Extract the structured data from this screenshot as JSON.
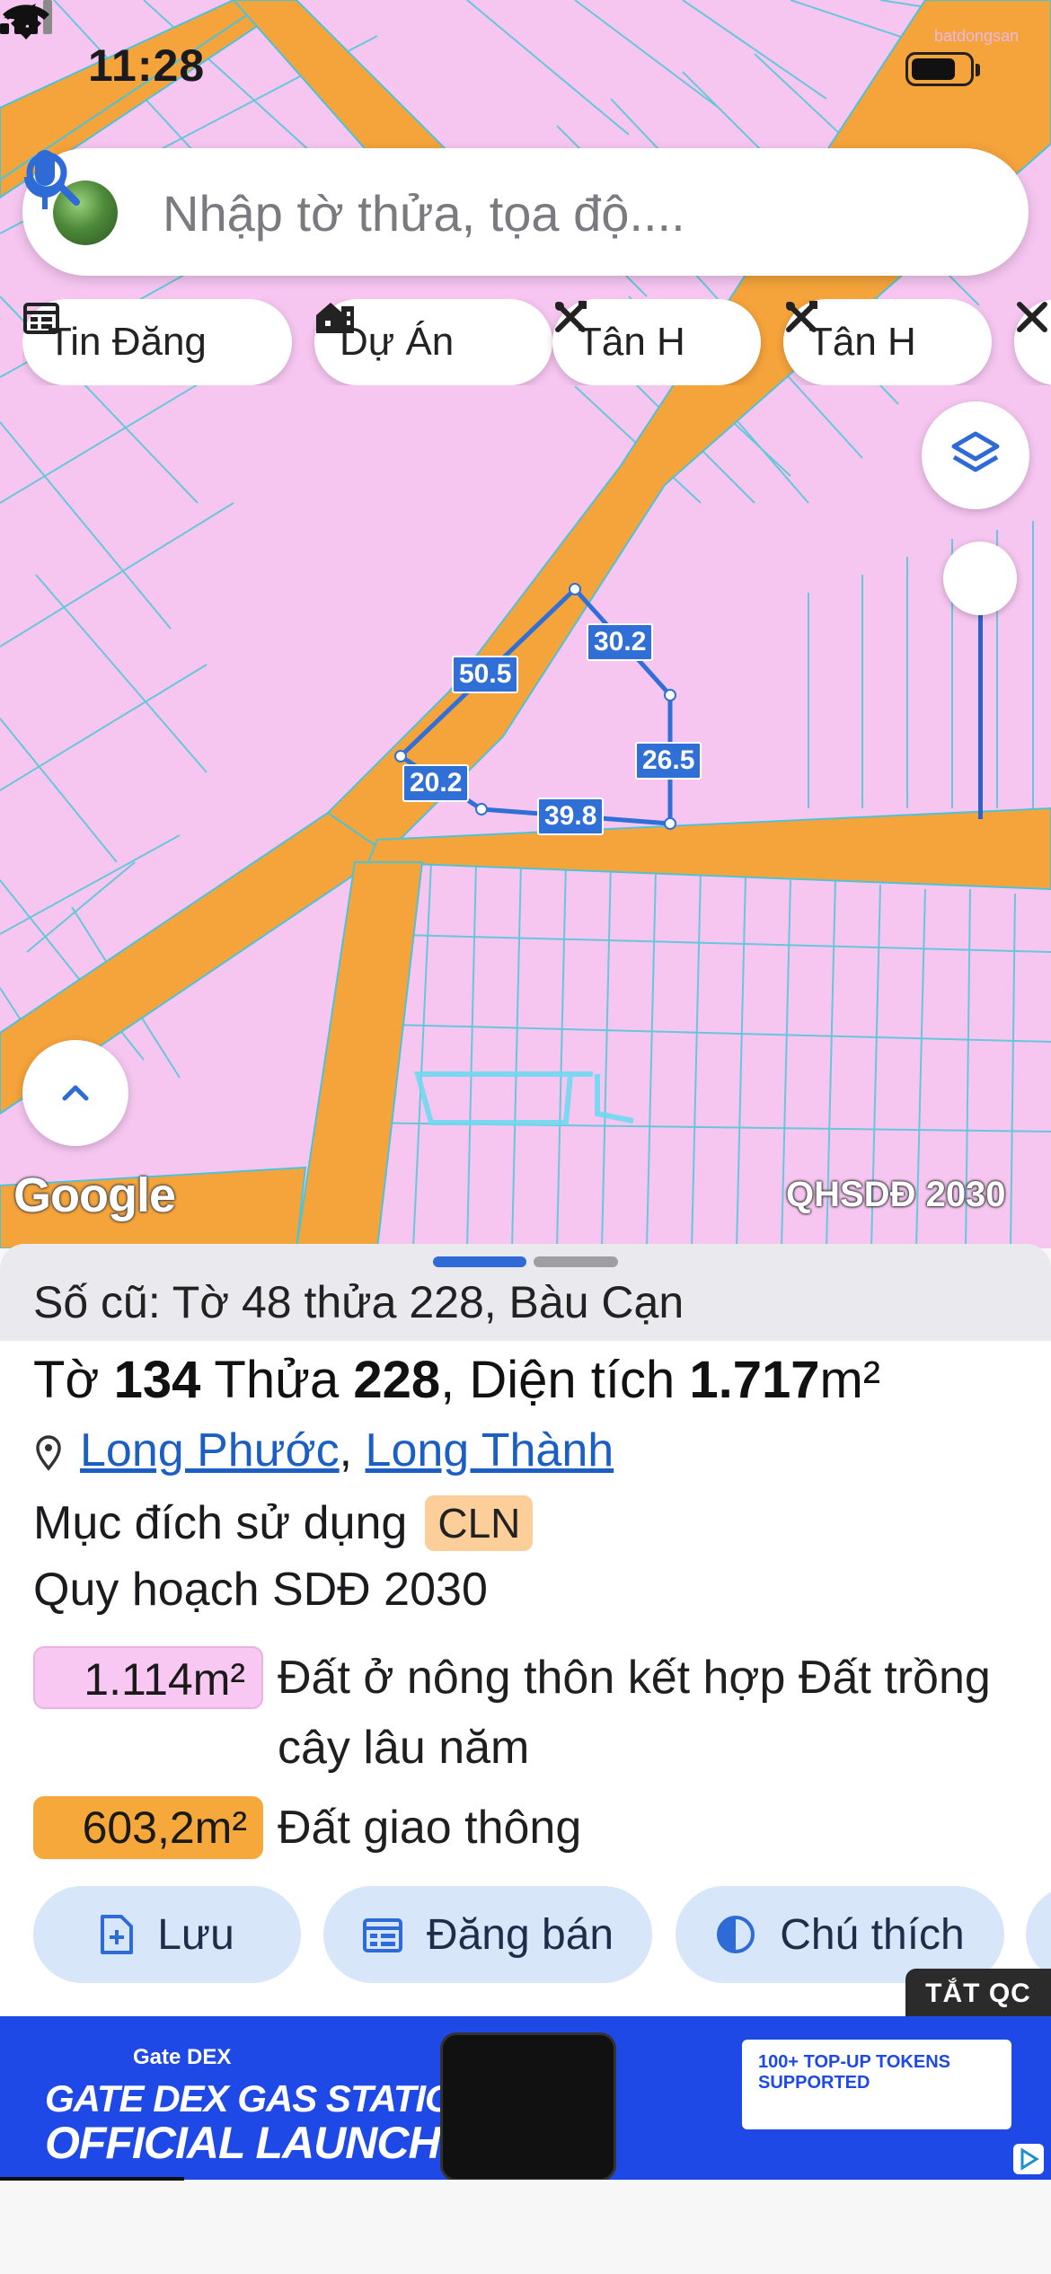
{
  "status_bar": {
    "time": "11:28",
    "watermark": "batdongsan"
  },
  "search": {
    "placeholder": "Nhập tờ thửa, tọa độ...."
  },
  "chips": [
    {
      "label": "Tin Đăng",
      "icon": "calendar-icon"
    },
    {
      "label": "Dự Án",
      "icon": "building-icon"
    },
    {
      "label": "Tân H",
      "icon": "crossed-tools-icon"
    },
    {
      "label": "Tân H",
      "icon": "crossed-tools-icon"
    }
  ],
  "map": {
    "dimensions": [
      "50.5",
      "30.2",
      "26.5",
      "39.8",
      "20.2"
    ],
    "attribution": "Google",
    "plan_label": "QHSDĐ 2030"
  },
  "sheet": {
    "old_info": "Số cũ: Tờ 48 thửa 228, Bàu Cạn",
    "title_prefix": "Tờ ",
    "sheet_no": "134",
    "parcel_word": " Thửa ",
    "parcel_no": "228",
    "area_word": ", Diện tích ",
    "area_value": "1.717",
    "area_unit": "m²",
    "ward": "Long Phước",
    "separator": ", ",
    "district": "Long Thành",
    "purpose_label": "Mục đích sử dụng",
    "purpose_code": "CLN",
    "plan_title": "Quy hoạch SDĐ 2030",
    "plan_items": [
      {
        "area": "1.114m²",
        "desc": "Đất ở nông thôn kết hợp Đất trồng cây lâu năm",
        "color": "#f8c8f3"
      },
      {
        "area": "603,2m²",
        "desc": "Đất giao thông",
        "color": "#f7a83a"
      }
    ]
  },
  "actions": [
    {
      "label": "Lưu",
      "icon": "add-file-icon"
    },
    {
      "label": "Đăng bán",
      "icon": "calendar-list-icon"
    },
    {
      "label": "Chú thích",
      "icon": "contrast-icon"
    }
  ],
  "ad": {
    "close_label": "TẮT QC",
    "brand": "Gate DEX",
    "headline_1": "GATE DEX GAS STATION",
    "headline_2": "OFFICIAL LAUNCH",
    "card_title": "100+ TOP-UP TOKENS SUPPORTED"
  },
  "colors": {
    "map_land": "#f6c6f1",
    "road": "#f5a33b",
    "parcel_line": "#2f6fd6",
    "accent": "#2e6bd6"
  }
}
